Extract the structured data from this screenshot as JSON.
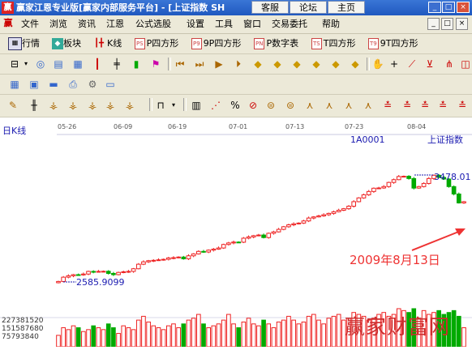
{
  "title_bar": {
    "logo": "赢",
    "title": "赢家江恩专业版[赢家内部服务平台] - [上证指数 SH",
    "tabs": [
      "客服",
      "论坛",
      "主页"
    ],
    "window_buttons": [
      "_",
      "□",
      "×"
    ]
  },
  "menu_bar": {
    "logo": "赢",
    "items": [
      "文件",
      "浏览",
      "资讯",
      "江恩",
      "公式选股",
      "设置",
      "工具",
      "窗口",
      "交易委托",
      "帮助"
    ],
    "mdi_buttons": [
      "_",
      "□",
      "×"
    ]
  },
  "toolbar1": {
    "items": [
      {
        "tag": "",
        "label": "行情"
      },
      {
        "tag": "",
        "label": "板块"
      },
      {
        "tag": "",
        "label": "K线"
      },
      {
        "tag": "PS",
        "label": "P四方形"
      },
      {
        "tag": "P9",
        "label": "9P四方形"
      },
      {
        "tag": "PN",
        "label": "P数字表"
      },
      {
        "tag": "TS",
        "label": "T四方形"
      },
      {
        "tag": "T9",
        "label": "9T四方形"
      }
    ]
  },
  "chart_header": {
    "period": "日K线",
    "dates": [
      "05-26",
      "06-09",
      "06-19",
      "07-01",
      "07-13",
      "07-23",
      "08-04"
    ],
    "code": "1A0001",
    "name": "上证指数"
  },
  "annotations": {
    "low_label": "2585.9099",
    "high_label": "3478.01",
    "date_note": "2009年8月13日"
  },
  "volume_axis": [
    "227381520",
    "151587680",
    "75793840"
  ],
  "watermark": "赢家财富网",
  "colors": {
    "up": "#ee2222",
    "down": "#00aa00",
    "label": "#1a1ab0",
    "annotation": "#ee3333"
  },
  "chart_data": {
    "type": "candlestick",
    "x": [
      1,
      2,
      3,
      4,
      5,
      6,
      7,
      8,
      9,
      10,
      11,
      12,
      13,
      14,
      15,
      16,
      17,
      18,
      19,
      20,
      21,
      22,
      23,
      24,
      25,
      26,
      27,
      28,
      29,
      30,
      31,
      32,
      33,
      34,
      35,
      36,
      37,
      38,
      39,
      40,
      41,
      42,
      43,
      44,
      45,
      46,
      47,
      48,
      49,
      50,
      51,
      52,
      53,
      54,
      55,
      56,
      57,
      58,
      59,
      60,
      61,
      62,
      63,
      64,
      65,
      66,
      67,
      68,
      69,
      70,
      71,
      72,
      73,
      74,
      75,
      76,
      77,
      78,
      79,
      80,
      81,
      82
    ],
    "series": [
      {
        "open": [
          2586,
          2596,
          2630,
          2641,
          2650,
          2648,
          2655,
          2676,
          2672,
          2676,
          2677,
          2660,
          2650,
          2668,
          2673,
          2676,
          2697,
          2733,
          2752,
          2761,
          2764,
          2768,
          2772,
          2783,
          2785,
          2790,
          2776,
          2800,
          2815,
          2835,
          2830,
          2845,
          2853,
          2862,
          2890,
          2902,
          2909,
          2908,
          2940,
          2950,
          2960,
          2965,
          2945,
          2979,
          2990,
          3010,
          3031,
          3046,
          3054,
          3060,
          3077,
          3100,
          3109,
          3117,
          3126,
          3137,
          3150,
          3162,
          3174,
          3194,
          3230,
          3260,
          3285,
          3311,
          3337,
          3339,
          3350,
          3383,
          3405,
          3430,
          3432,
          3414,
          3338,
          3350,
          3375,
          3414,
          3440,
          3423,
          3410,
          3350,
          3291,
          3220
        ],
        "close": [
          2596,
          2630,
          2641,
          2650,
          2648,
          2655,
          2676,
          2672,
          2676,
          2677,
          2660,
          2650,
          2668,
          2673,
          2676,
          2697,
          2733,
          2752,
          2761,
          2764,
          2768,
          2772,
          2783,
          2785,
          2790,
          2776,
          2800,
          2815,
          2835,
          2830,
          2845,
          2853,
          2862,
          2890,
          2902,
          2909,
          2908,
          2940,
          2950,
          2960,
          2965,
          2945,
          2979,
          2990,
          3010,
          3031,
          3046,
          3054,
          3060,
          3077,
          3100,
          3109,
          3117,
          3126,
          3137,
          3150,
          3162,
          3174,
          3194,
          3230,
          3260,
          3285,
          3311,
          3337,
          3339,
          3350,
          3383,
          3405,
          3430,
          3432,
          3414,
          3338,
          3350,
          3375,
          3414,
          3440,
          3423,
          3410,
          3350,
          3291,
          3220,
          3230
        ],
        "volume_ratio": [
          0.3,
          0.5,
          0.45,
          0.55,
          0.5,
          0.4,
          0.45,
          0.55,
          0.5,
          0.45,
          0.6,
          0.5,
          0.35,
          0.55,
          0.5,
          0.45,
          0.7,
          0.8,
          0.65,
          0.55,
          0.5,
          0.45,
          0.55,
          0.6,
          0.5,
          0.6,
          0.7,
          0.75,
          0.85,
          0.6,
          0.5,
          0.55,
          0.6,
          0.7,
          0.85,
          0.6,
          0.5,
          0.65,
          0.75,
          0.6,
          0.55,
          0.7,
          0.6,
          0.5,
          0.65,
          0.7,
          0.8,
          0.7,
          0.6,
          0.65,
          0.8,
          0.85,
          0.7,
          0.6,
          0.75,
          0.8,
          0.85,
          0.7,
          0.75,
          0.9,
          0.85,
          0.8,
          0.7,
          0.75,
          0.85,
          0.9,
          0.8,
          0.85,
          1.0,
          0.95,
          0.9,
          1.0,
          0.75,
          0.95,
          0.85,
          0.9,
          0.95,
          0.85,
          0.9,
          0.95,
          0.8,
          0.5
        ]
      }
    ]
  }
}
